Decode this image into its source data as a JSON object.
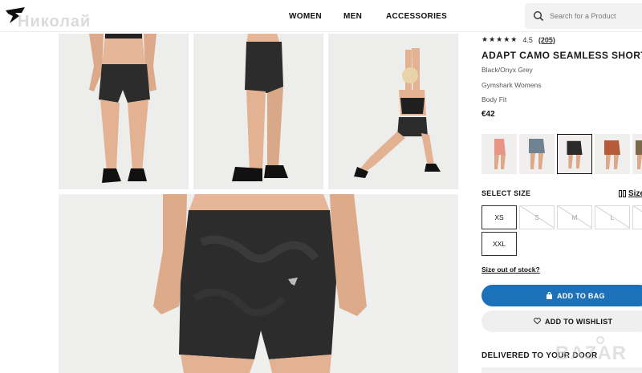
{
  "header": {
    "watermark": "Николай",
    "nav": [
      "WOMEN",
      "MEN",
      "ACCESSORIES"
    ],
    "search_placeholder": "Search for a Product"
  },
  "product": {
    "stars": "★★★★★",
    "rating": "4.5",
    "reviews": "(205)",
    "title": "ADAPT CAMO SEAMLESS SHORTS",
    "color": "Black/Onyx Grey",
    "collection": "Gymshark Womens",
    "fit": "Body Fit",
    "price": "€42"
  },
  "swatches": [
    {
      "name": "coral",
      "color": "#e89585"
    },
    {
      "name": "blue-grey",
      "color": "#6f8393"
    },
    {
      "name": "black",
      "color": "#2a2a2a",
      "selected": true
    },
    {
      "name": "rust",
      "color": "#b65a38"
    },
    {
      "name": "olive",
      "color": "#7a6a48"
    }
  ],
  "sizes": {
    "label": "SELECT SIZE",
    "guide": "Size guide",
    "options": [
      {
        "label": "XS",
        "available": true
      },
      {
        "label": "S",
        "available": false
      },
      {
        "label": "M",
        "available": false
      },
      {
        "label": "L",
        "available": false
      },
      {
        "label": "XL",
        "available": false
      },
      {
        "label": "XXL",
        "available": true
      }
    ],
    "out_of_stock_link": "Size out of stock?"
  },
  "actions": {
    "add_to_bag": "ADD TO BAG",
    "add_to_wishlist": "ADD TO WISHLIST"
  },
  "delivery": {
    "title": "DELIVERED TO YOUR DOOR"
  },
  "watermark_bottom": "BAZAR",
  "colors": {
    "accent": "#1d71b8",
    "shorts": "#2c2c2c",
    "skin": "#e7b899"
  }
}
